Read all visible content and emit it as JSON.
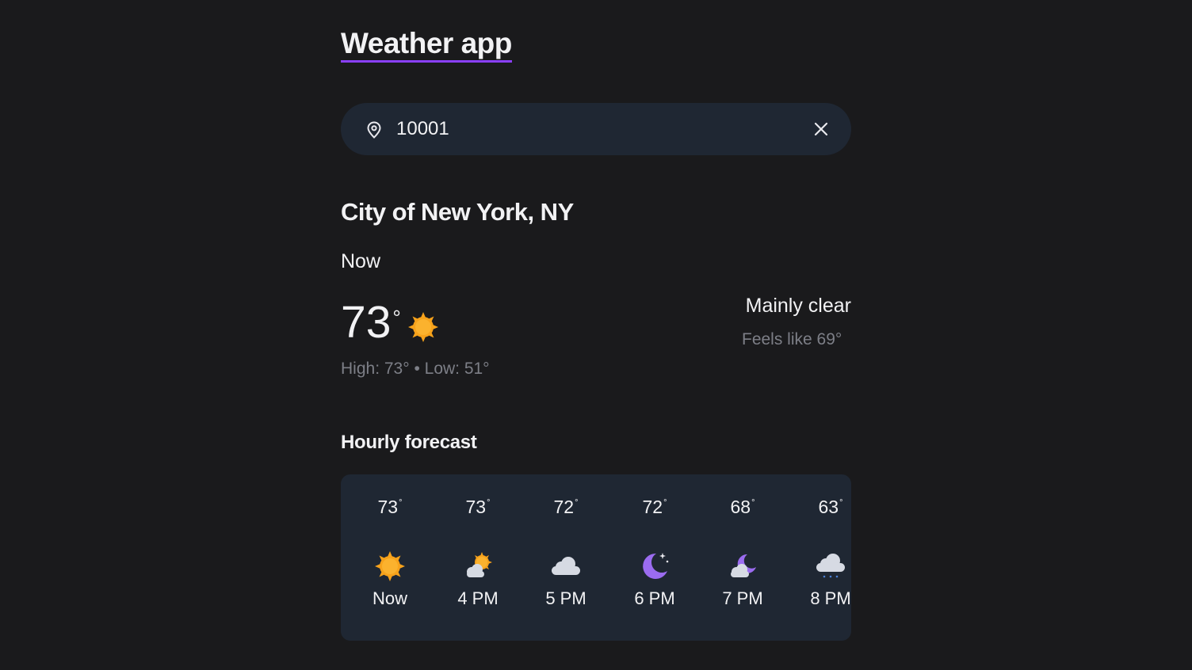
{
  "app": {
    "title": "Weather app",
    "accent_color": "#8a3ffc"
  },
  "search": {
    "value": "10001",
    "icon": "location-pin-icon",
    "clear_icon": "close-icon"
  },
  "location": {
    "name": "City of New York, NY"
  },
  "current": {
    "label": "Now",
    "temp": "73",
    "degree": "°",
    "icon": "sun-icon",
    "high_low": "High: 73° • Low: 51°",
    "condition": "Mainly clear",
    "feels_like": "Feels like 69°"
  },
  "hourly": {
    "title": "Hourly forecast",
    "items": [
      {
        "temp": "73",
        "label": "Now",
        "icon": "sun-icon"
      },
      {
        "temp": "73",
        "label": "4 PM",
        "icon": "partly-cloudy-icon"
      },
      {
        "temp": "72",
        "label": "5 PM",
        "icon": "cloud-icon"
      },
      {
        "temp": "72",
        "label": "6 PM",
        "icon": "moon-icon"
      },
      {
        "temp": "68",
        "label": "7 PM",
        "icon": "partly-cloudy-night-icon"
      },
      {
        "temp": "63",
        "label": "8 PM",
        "icon": "drizzle-icon"
      }
    ]
  },
  "colors": {
    "background": "#1a1a1c",
    "card": "#1f2733",
    "muted_text": "#7d7f87",
    "sun": "#f7a21b",
    "moon": "#9b6cf0"
  }
}
